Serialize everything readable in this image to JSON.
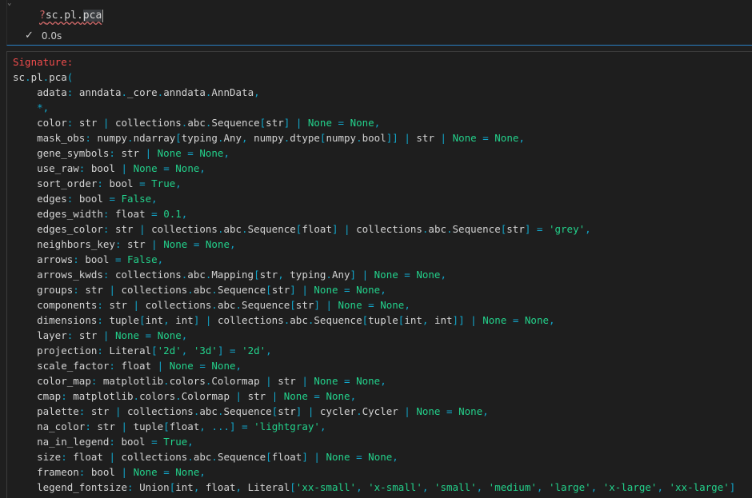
{
  "cell": {
    "prefix": "?",
    "code": "sc.pl.",
    "code_selected": "pca",
    "status_time": "0.0s",
    "status_icon": "check-icon"
  },
  "output": {
    "header": "Signature:",
    "open": "sc.pl.pca(",
    "params": [
      {
        "name": "adata",
        "type": "anndata._core.anndata.AnnData",
        "default": null
      },
      {
        "name": "*",
        "type": null,
        "default": null
      },
      {
        "name": "color",
        "type": "str | collections.abc.Sequence[str] | None",
        "default": "None"
      },
      {
        "name": "mask_obs",
        "type": "numpy.ndarray[typing.Any, numpy.dtype[numpy.bool]] | str | None",
        "default": "None"
      },
      {
        "name": "gene_symbols",
        "type": "str | None",
        "default": "None"
      },
      {
        "name": "use_raw",
        "type": "bool | None",
        "default": "None"
      },
      {
        "name": "sort_order",
        "type": "bool",
        "default": "True"
      },
      {
        "name": "edges",
        "type": "bool",
        "default": "False"
      },
      {
        "name": "edges_width",
        "type": "float",
        "default": "0.1"
      },
      {
        "name": "edges_color",
        "type": "str | collections.abc.Sequence[float] | collections.abc.Sequence[str]",
        "default": "'grey'"
      },
      {
        "name": "neighbors_key",
        "type": "str | None",
        "default": "None"
      },
      {
        "name": "arrows",
        "type": "bool",
        "default": "False"
      },
      {
        "name": "arrows_kwds",
        "type": "collections.abc.Mapping[str, typing.Any] | None",
        "default": "None"
      },
      {
        "name": "groups",
        "type": "str | collections.abc.Sequence[str] | None",
        "default": "None"
      },
      {
        "name": "components",
        "type": "str | collections.abc.Sequence[str] | None",
        "default": "None"
      },
      {
        "name": "dimensions",
        "type": "tuple[int, int] | collections.abc.Sequence[tuple[int, int]] | None",
        "default": "None"
      },
      {
        "name": "layer",
        "type": "str | None",
        "default": "None"
      },
      {
        "name": "projection",
        "type": "Literal['2d', '3d']",
        "default": "'2d'"
      },
      {
        "name": "scale_factor",
        "type": "float | None",
        "default": "None"
      },
      {
        "name": "color_map",
        "type": "matplotlib.colors.Colormap | str | None",
        "default": "None"
      },
      {
        "name": "cmap",
        "type": "matplotlib.colors.Colormap | str | None",
        "default": "None"
      },
      {
        "name": "palette",
        "type": "str | collections.abc.Sequence[str] | cycler.Cycler | None",
        "default": "None"
      },
      {
        "name": "na_color",
        "type": "str | tuple[float, ...]",
        "default": "'lightgray'"
      },
      {
        "name": "na_in_legend",
        "type": "bool",
        "default": "True"
      },
      {
        "name": "size",
        "type": "float | collections.abc.Sequence[float] | None",
        "default": "None"
      },
      {
        "name": "frameon",
        "type": "bool | None",
        "default": "None"
      },
      {
        "name": "legend_fontsize",
        "type": "Union[int, float, Literal['xx-small', 'x-small', 'small', 'medium', 'large', 'x-large', 'xx-large']",
        "default": null
      }
    ]
  },
  "colors": {
    "header": "#f14c4c",
    "keyword": "#23d18b",
    "punct": "#11a8cd",
    "text": "#d4d4d4",
    "accent_border": "#2a80c5"
  }
}
